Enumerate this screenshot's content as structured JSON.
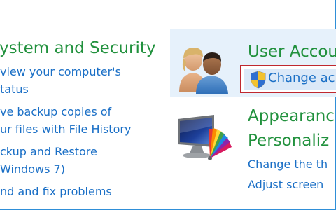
{
  "system_security": {
    "title": "ystem and Security",
    "links": [
      {
        "line1": "view your computer's",
        "line2": "tatus"
      },
      {
        "line1": "ve backup copies of",
        "line2": "ur files with File History"
      },
      {
        "line1": "ckup and Restore",
        "line2": "Windows 7)"
      },
      {
        "line1": "nd and fix problems"
      }
    ]
  },
  "user_accounts": {
    "title": "User Accou",
    "change_link": "Change ac",
    "icon": "users-icon",
    "shield_icon": "uac-shield-icon"
  },
  "appearance": {
    "title_line1": "Appearanc",
    "title_line2": "Personaliz",
    "links": [
      "Change the th",
      "Adjust screen"
    ],
    "icon": "monitor-color-palette-icon"
  },
  "colors": {
    "category_green": "#21913d",
    "link_blue": "#1a6fc6",
    "highlight": "#e6f1fb",
    "focus_red": "#c0282f"
  }
}
